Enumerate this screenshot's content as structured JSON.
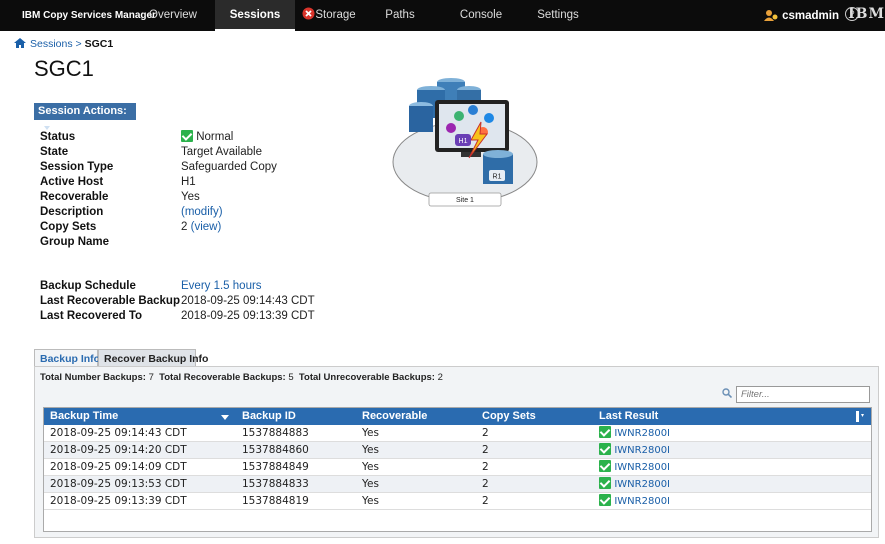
{
  "nav": {
    "brand": "IBM Copy Services Manager",
    "items": [
      {
        "label": "Overview"
      },
      {
        "label": "Sessions"
      },
      {
        "label": "Storage"
      },
      {
        "label": "Paths"
      },
      {
        "label": "Console"
      },
      {
        "label": "Settings"
      }
    ],
    "active": "Sessions",
    "user": "csmadmin",
    "help": "?",
    "logo": "IBM"
  },
  "breadcrumb": {
    "parent": "Sessions",
    "separator": ">",
    "current": "SGC1"
  },
  "page_title": "SGC1",
  "session_actions_label": "Session Actions:",
  "details": [
    {
      "label": "Status",
      "value": "Normal"
    },
    {
      "label": "State",
      "value": "Target Available"
    },
    {
      "label": "Session Type",
      "value": "Safeguarded Copy"
    },
    {
      "label": "Active Host",
      "value": "H1"
    },
    {
      "label": "Recoverable",
      "value": "Yes"
    },
    {
      "label": "Description",
      "value": "(modify)"
    },
    {
      "label": "Copy Sets",
      "value": "2",
      "link": "(view)"
    },
    {
      "label": "Group Name",
      "value": ""
    }
  ],
  "schedule": [
    {
      "label": "Backup Schedule",
      "value": "Every 1.5 hours"
    },
    {
      "label": "Last Recoverable Backup",
      "value": "2018-09-25 09:14:43 CDT"
    },
    {
      "label": "Last Recovered To",
      "value": "2018-09-25 09:13:39 CDT"
    }
  ],
  "diagram": {
    "site_label": "Site 1",
    "host_label": "H1",
    "volume_label": "R1"
  },
  "tabs": [
    {
      "label": "Backup Info",
      "selected": true
    },
    {
      "label": "Recover Backup Info",
      "selected": false
    }
  ],
  "totals": {
    "total_label": "Total Number Backups:",
    "total": "7",
    "recoverable_label": "Total Recoverable Backups:",
    "recoverable": "5",
    "unrecoverable_label": "Total Unrecoverable Backups:",
    "unrecoverable": "2"
  },
  "filter": {
    "placeholder": "Filter..."
  },
  "table": {
    "columns": [
      "Backup Time",
      "Backup ID",
      "Recoverable",
      "Copy Sets",
      "Last Result"
    ],
    "rows": [
      {
        "time": "2018-09-25 09:14:43 CDT",
        "id": "1537884883",
        "recoverable": "Yes",
        "copy_sets": "2",
        "result": "IWNR2800I"
      },
      {
        "time": "2018-09-25 09:14:20 CDT",
        "id": "1537884860",
        "recoverable": "Yes",
        "copy_sets": "2",
        "result": "IWNR2800I"
      },
      {
        "time": "2018-09-25 09:14:09 CDT",
        "id": "1537884849",
        "recoverable": "Yes",
        "copy_sets": "2",
        "result": "IWNR2800I"
      },
      {
        "time": "2018-09-25 09:13:53 CDT",
        "id": "1537884833",
        "recoverable": "Yes",
        "copy_sets": "2",
        "result": "IWNR2800I"
      },
      {
        "time": "2018-09-25 09:13:39 CDT",
        "id": "1537884819",
        "recoverable": "Yes",
        "copy_sets": "2",
        "result": "IWNR2800I"
      }
    ]
  },
  "colors": {
    "accent": "#2a6bb0",
    "ok": "#2bb24c",
    "error": "#d9342b",
    "topbar": "#0c0c0c"
  }
}
